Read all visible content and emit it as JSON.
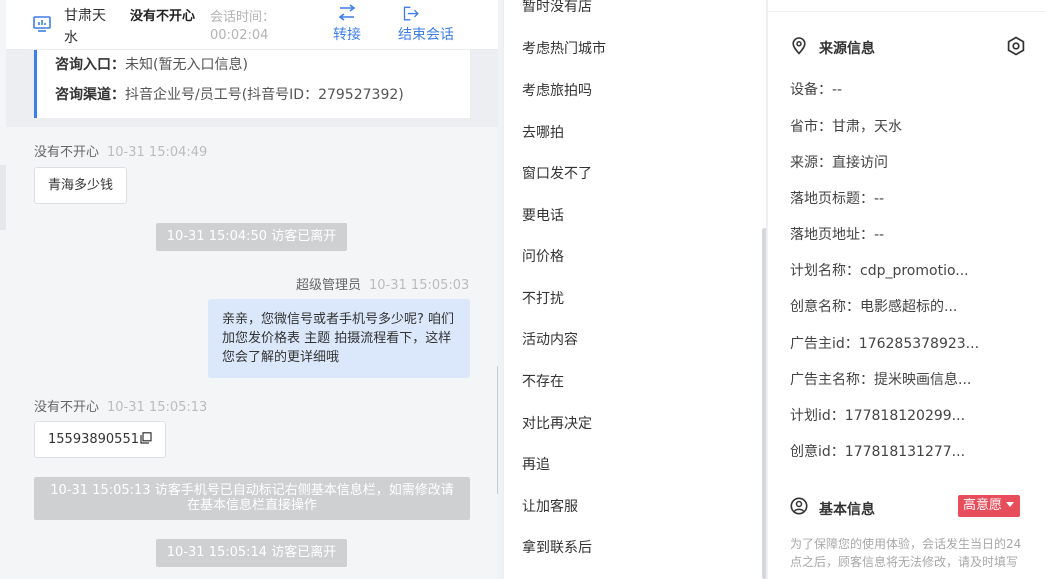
{
  "header": {
    "visitor_location": "甘肃天水",
    "visitor_name": "没有不开心",
    "session_time_label": "会话时间：",
    "session_time_value": "00:02:04",
    "transfer_label": "转接",
    "end_session_label": "结束会话"
  },
  "consult_info": {
    "entry_label": "咨询入口：",
    "entry_value": "未知(暂无入口信息)",
    "channel_label": "咨询渠道：",
    "channel_value": "抖音企业号/员工号(抖音号ID：279527392)"
  },
  "messages": [
    {
      "sender": "没有不开心",
      "time": "10-31 15:04:49",
      "text": "青海多少钱"
    },
    {
      "system": "10-31 15:04:50 访客已离开"
    },
    {
      "sender": "超级管理员",
      "time": "10-31 15:05:03",
      "text": "亲亲，您微信号或者手机号多少呢? 咱们加您发价格表 主题 拍摄流程看下，这样您会了解的更详细哦"
    },
    {
      "sender": "没有不开心",
      "time": "10-31 15:05:13",
      "text": "15593890551"
    },
    {
      "system": "10-31 15:05:13 访客手机号已自动标记右侧基本信息栏，如需修改请在基本信息栏直接操作"
    },
    {
      "system": "10-31 15:05:14 访客已离开"
    }
  ],
  "quick_phrases": [
    "暂时没有店",
    "考虑热门城市",
    "考虑旅拍吗",
    "去哪拍",
    "窗口发不了",
    "要电话",
    "问价格",
    "不打扰",
    "活动内容",
    "不存在",
    "对比再决定",
    "再追",
    "让加客服",
    "拿到联系后"
  ],
  "source_info": {
    "title": "来源信息",
    "fields": [
      {
        "label": "设备：",
        "value": "--"
      },
      {
        "label": "省市：",
        "value": "甘肃，天水"
      },
      {
        "label": "来源：",
        "value": "直接访问"
      },
      {
        "label": "落地页标题：",
        "value": "--"
      },
      {
        "label": "落地页地址：",
        "value": "--"
      },
      {
        "label": "计划名称：",
        "value": "cdp_promotio..."
      },
      {
        "label": "创意名称：",
        "value": "电影感超标的..."
      },
      {
        "label": "广告主id：",
        "value": "176285378923..."
      },
      {
        "label": "广告主名称：",
        "value": "提米映画信息..."
      },
      {
        "label": "计划id：",
        "value": "177818120299..."
      },
      {
        "label": "创意id：",
        "value": "177818131277..."
      }
    ]
  },
  "basic_info": {
    "title": "基本信息",
    "intent_badge": "高意愿",
    "notice": "为了保障您的使用体验，会话发生当日的24点之后，顾客信息将无法修改，请及时填写"
  },
  "colors": {
    "accent": "#3d7ee8",
    "badge": "#e84d5b",
    "outgoing_bubble": "#dbe8fb",
    "system_tip": "#cfd0d2"
  },
  "icons": [
    "monitor-icon",
    "transfer-icon",
    "exit-icon",
    "location-pin-icon",
    "settings-hex-icon",
    "user-circle-icon",
    "copy-icon"
  ]
}
